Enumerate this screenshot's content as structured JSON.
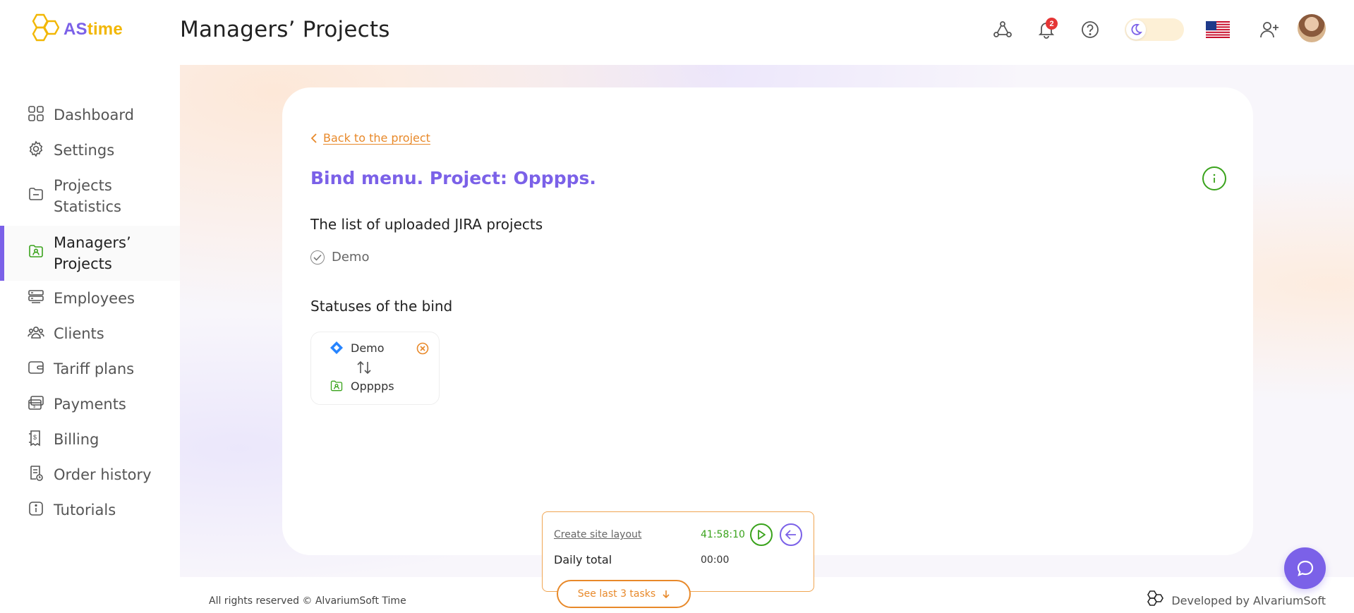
{
  "brand": {
    "as": "AS",
    "time": "time"
  },
  "header": {
    "title": "Managers’ Projects",
    "notifications_count": "2"
  },
  "sidebar": {
    "items": [
      {
        "label": "Dashboard",
        "icon": "grid-icon"
      },
      {
        "label": "Settings",
        "icon": "gear-icon"
      },
      {
        "label": "Projects Statistics",
        "icon": "folder-icon"
      },
      {
        "label": "Managers’ Projects",
        "icon": "manager-folder-icon",
        "active": true
      },
      {
        "label": "Employees",
        "icon": "employees-icon"
      },
      {
        "label": "Clients",
        "icon": "clients-icon"
      },
      {
        "label": "Tariff plans",
        "icon": "wallet-icon"
      },
      {
        "label": "Payments",
        "icon": "payments-icon"
      },
      {
        "label": "Billing",
        "icon": "billing-icon"
      },
      {
        "label": "Order history",
        "icon": "order-history-icon"
      },
      {
        "label": "Tutorials",
        "icon": "info-icon"
      }
    ]
  },
  "main": {
    "back_link": "Back to the project",
    "title": "Bind menu. Project: Opppps.",
    "uploaded_title": "The list of uploaded JIRA projects",
    "uploaded_projects": [
      "Demo"
    ],
    "statuses_title": "Statuses of the bind",
    "bind": {
      "jira_project": "Demo",
      "local_project": "Opppps"
    }
  },
  "timer": {
    "task": "Create site layout",
    "time": "41:58:10",
    "daily_label": "Daily total",
    "daily_value": "00:00",
    "see_last": "See last 3 tasks"
  },
  "footer": {
    "copyright": "All rights reserved © AlvariumSoft Time",
    "developed_by": "Developed by AlvariumSoft"
  },
  "colors": {
    "accent": "#7b61e8",
    "orange": "#e8892a",
    "green": "#3aa31c",
    "yellow": "#f2b705"
  }
}
